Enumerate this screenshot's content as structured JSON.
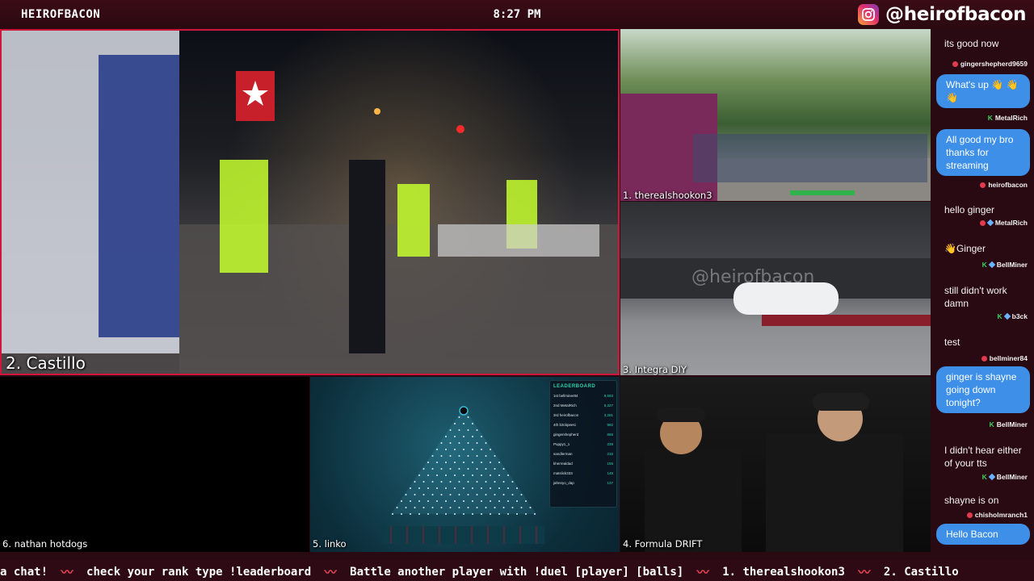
{
  "topbar": {
    "brand": "HEIROFBACON",
    "time": "8:27 PM",
    "instagram_handle": "@heirofbacon"
  },
  "panels": {
    "main": {
      "label": "2. Castillo"
    },
    "p1": {
      "label": "1. therealshookon3"
    },
    "p3": {
      "label": "3. Integra DIY"
    },
    "p6": {
      "label": "6. nathan hotdogs"
    },
    "p5": {
      "label": "5. linko"
    },
    "p4": {
      "label": "4. Formula DRIFT"
    }
  },
  "plinko": {
    "leaderboard_title": "LEADERBOARD",
    "rows": [
      {
        "rank": "1st",
        "name": "bellminer84",
        "value": "9,593"
      },
      {
        "rank": "2nd",
        "name": "MetalRich",
        "value": "5,327"
      },
      {
        "rank": "3rd",
        "name": "heirofbacon",
        "value": "3,281"
      },
      {
        "rank": "4th",
        "name": "b3ckpeesi",
        "value": "982"
      },
      {
        "rank": "",
        "name": "gingershepherd",
        "value": "865"
      },
      {
        "rank": "",
        "name": "Puppy1_1",
        "value": "239"
      },
      {
        "rank": "",
        "name": "sandlerman",
        "value": "216"
      },
      {
        "rank": "",
        "name": "kherrealdad",
        "value": "155"
      },
      {
        "rank": "",
        "name": "matslick333",
        "value": "148"
      },
      {
        "rank": "",
        "name": "jahnnyo_dap",
        "value": "137"
      }
    ]
  },
  "chat": {
    "messages": [
      {
        "type": "plain",
        "text": "its good now"
      },
      {
        "type": "user",
        "user": "gingershepherd9659",
        "badge": "dot"
      },
      {
        "type": "bubble",
        "text": "What's up 👋 👋👋"
      },
      {
        "type": "user",
        "user": "MetalRich",
        "badge": "k"
      },
      {
        "type": "bubble",
        "text": "All good my bro thanks for streaming"
      },
      {
        "type": "user",
        "user": "heirofbacon",
        "badge": "dot"
      },
      {
        "type": "plain",
        "text": "hello ginger"
      },
      {
        "type": "user",
        "user": "MetalRich",
        "badge": "dotdiamond"
      },
      {
        "type": "plain",
        "text": "👋Ginger"
      },
      {
        "type": "user",
        "user": "BellMiner",
        "badge": "kdiamond"
      },
      {
        "type": "plain",
        "text": "still didn't work damn"
      },
      {
        "type": "user",
        "user": "b3ck",
        "badge": "kdiamond"
      },
      {
        "type": "plain",
        "text": "test"
      },
      {
        "type": "user",
        "user": "bellminer84",
        "badge": "dot"
      },
      {
        "type": "bubble",
        "text": "ginger is shayne going down tonight?"
      },
      {
        "type": "user",
        "user": "BellMiner",
        "badge": "k"
      },
      {
        "type": "plain",
        "text": "I didn't hear either of your tts"
      },
      {
        "type": "user",
        "user": "BellMiner",
        "badge": "kdiamond"
      },
      {
        "type": "plain",
        "text": "shayne is on"
      },
      {
        "type": "user",
        "user": "chisholmranch1",
        "badge": "dot"
      },
      {
        "type": "bubble",
        "text": "Hello Bacon"
      }
    ]
  },
  "ticker": {
    "items": [
      "a chat!",
      "check your rank type !leaderboard",
      "Battle another player with !duel [player] [balls]",
      "1. therealshookon3",
      "2. Castillo"
    ]
  },
  "colors": {
    "frame": "#2a0a12",
    "accent_red": "#d0163a",
    "bubble_blue": "#3d8fe8",
    "leaderboard_teal": "#2dd4a8"
  }
}
